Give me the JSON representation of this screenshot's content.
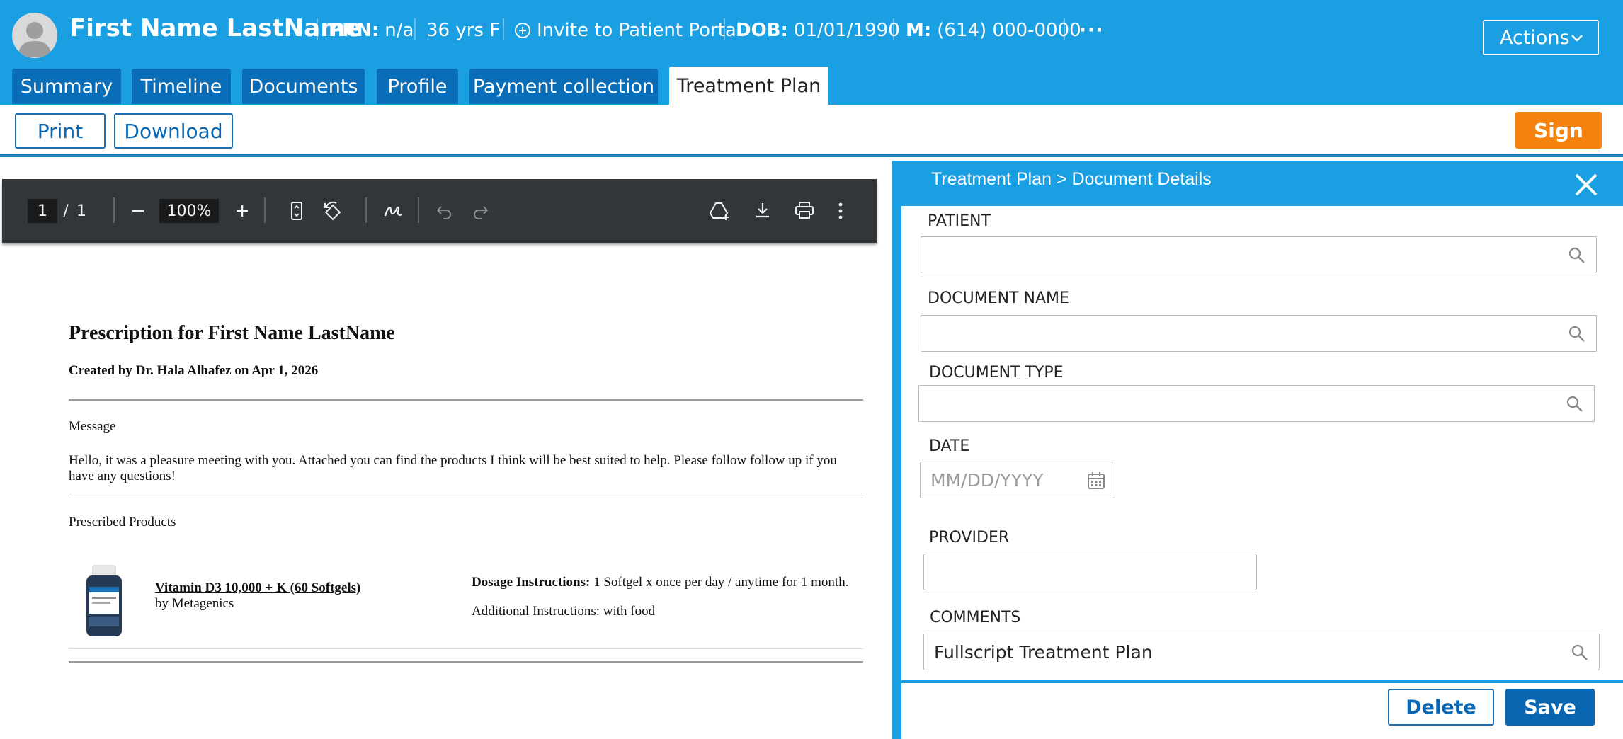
{
  "header": {
    "patient_name": "First Name LastName",
    "prn_label": "PRN:",
    "prn_value": "n/a",
    "age_sex": "36 yrs F",
    "invite_label": "Invite to Patient Portal",
    "dob_label": "DOB:",
    "dob_value": "01/01/1990",
    "mobile_label": "M:",
    "mobile_value": "(614) 000-0000",
    "more_label": "···",
    "actions_label": "Actions"
  },
  "tabs": [
    {
      "label": "Summary",
      "active": false
    },
    {
      "label": "Timeline",
      "active": false
    },
    {
      "label": "Documents",
      "active": false
    },
    {
      "label": "Profile",
      "active": false
    },
    {
      "label": "Payment collection",
      "active": false
    },
    {
      "label": "Treatment Plan",
      "active": true
    }
  ],
  "toolbar": {
    "print_label": "Print",
    "download_label": "Download",
    "sign_label": "Sign"
  },
  "pdf_viewer": {
    "page_current": "1",
    "page_sep": "/",
    "page_total": "1",
    "zoom": "100%"
  },
  "document": {
    "title": "Prescription for First Name LastName",
    "created_by": "Created by Dr. Hala Alhafez on Apr 1, 2026",
    "message_heading": "Message",
    "message_body": "Hello, it was a pleasure meeting with you. Attached you can find the products I think will be best suited to help. Please follow follow up if you have any questions!",
    "products_heading": "Prescribed Products",
    "product": {
      "name": "Vitamin D3 10,000 + K (60 Softgels)",
      "brand": "by Metagenics",
      "dosage_label": "Dosage Instructions:",
      "dosage_value": "1 Softgel x once per day / anytime for 1 month.",
      "additional": "Additional Instructions: with food"
    }
  },
  "panel": {
    "title": "Treatment Plan > Document Details",
    "fields": {
      "patient_label": "PATIENT",
      "patient_value": "",
      "document_name_label": "DOCUMENT NAME",
      "document_name_value": "",
      "document_type_label": "DOCUMENT TYPE",
      "document_type_value": "",
      "date_label": "DATE",
      "date_placeholder": "MM/DD/YYYY",
      "provider_label": "PROVIDER",
      "provider_value": "",
      "comments_label": "COMMENTS",
      "comments_value": "Fullscript Treatment Plan"
    },
    "delete_label": "Delete",
    "save_label": "Save"
  },
  "colors": {
    "header_blue": "#1a9fe3",
    "tab_blue": "#0a6db8",
    "sign_orange": "#f5820d",
    "save_blue": "#0a66b0"
  }
}
